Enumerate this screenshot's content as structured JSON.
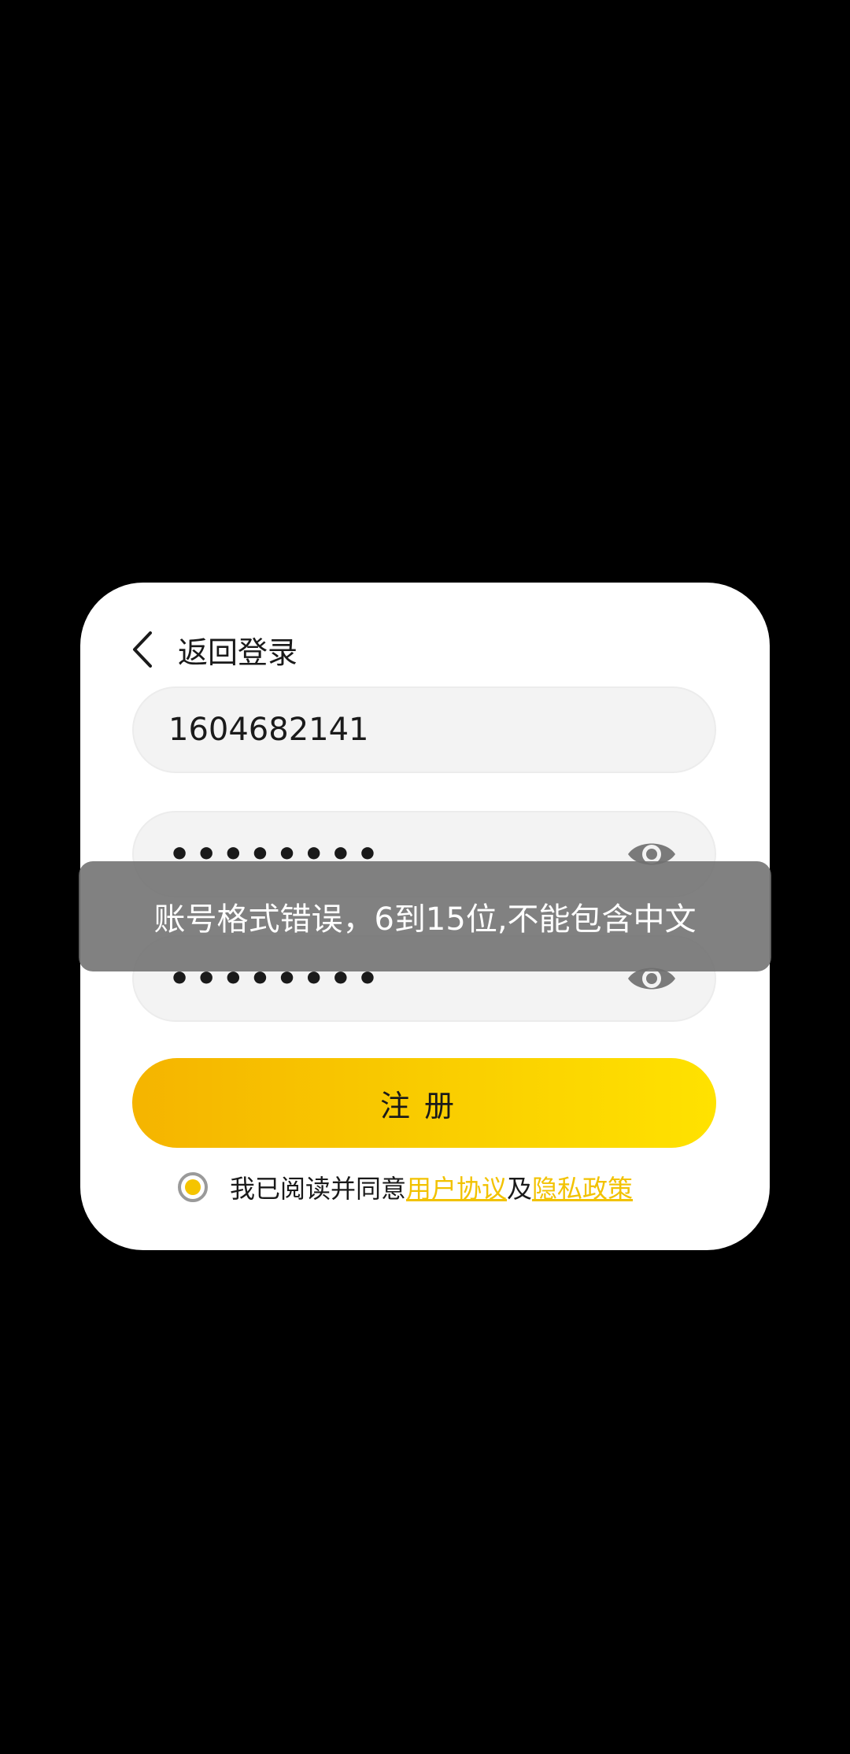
{
  "dialog": {
    "back_label": "返回登录",
    "account_value": "1604682141",
    "password_value": "••••••••",
    "confirm_password_value": "••••••••",
    "submit_label": "注册",
    "agreement": {
      "prefix": "我已阅读并同意",
      "user_agreement": "用户协议",
      "conjunction": "及",
      "privacy_policy": "隐私政策"
    }
  },
  "toast": {
    "message": "账号格式错误，6到15位,不能包含中文"
  },
  "icons": {
    "back": "chevron-left-icon",
    "eye": "eye-icon",
    "radio": "radio-checked-icon"
  },
  "colors": {
    "accent": "#f5c400",
    "button_start": "#f5b400",
    "button_end": "#ffe200",
    "background": "#000000",
    "toast_bg": "#707070"
  }
}
